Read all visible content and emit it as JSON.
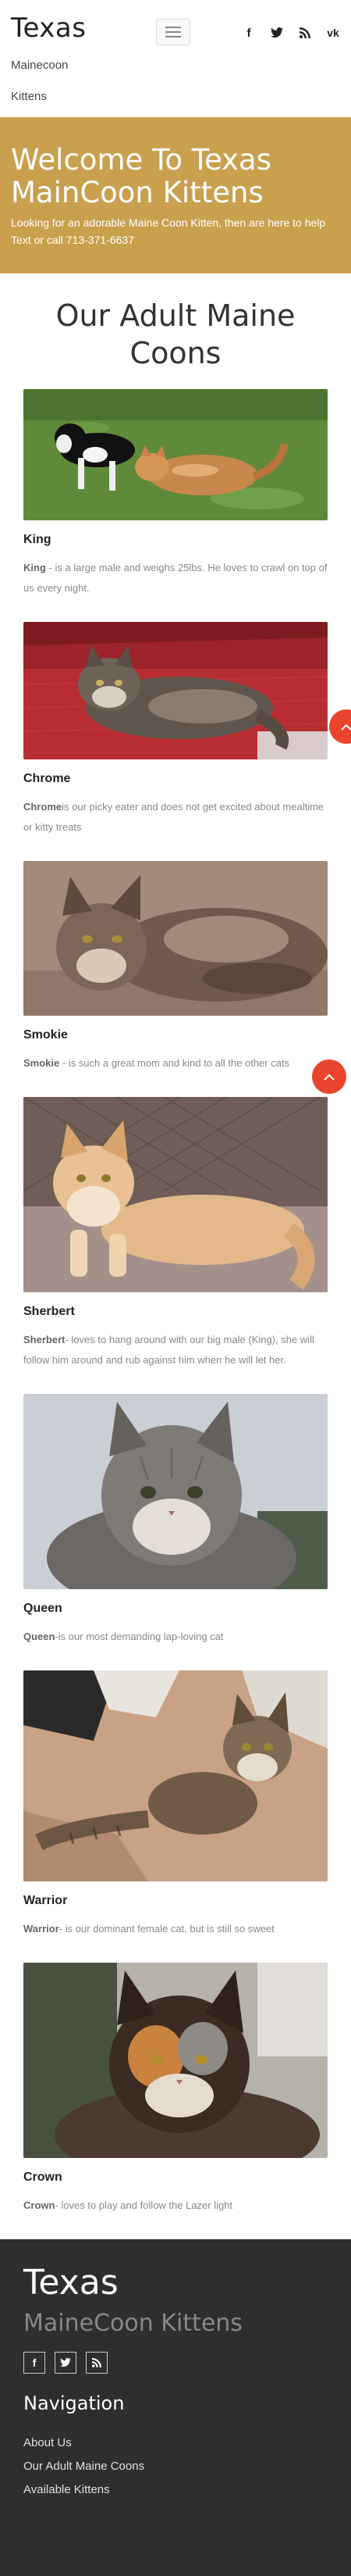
{
  "header": {
    "brand": "Texas",
    "nav": [
      "Mainecoon",
      "Kittens"
    ],
    "social_icons": [
      "facebook-icon",
      "twitter-icon",
      "rss-icon",
      "vk-icon"
    ]
  },
  "hero": {
    "title": "Welcome To Texas MainCoon Kittens",
    "subtitle": "Looking for an adorable Maine Coon Kitten, then are here to help",
    "contact": "Text or call 713-371-6637"
  },
  "section": {
    "title": "Our Adult Maine Coons"
  },
  "cats": [
    {
      "name": "King",
      "desc_strong": "King",
      "desc": " - is a large male and weighs 25lbs. He loves to crawl on top of us every night."
    },
    {
      "name": "Chrome",
      "desc_strong": "Chrome",
      "desc": "is our picky eater and does not get excited about mealtime or kitty treats"
    },
    {
      "name": "Smokie",
      "desc_strong": "Smokie",
      "desc": " - is such a great mom and kind to all the other cats"
    },
    {
      "name": "Sherbert",
      "desc_strong": "Sherbert",
      "desc": "- loves to hang around with our big male (King), she will follow him around and rub against him when he will let her."
    },
    {
      "name": "Queen",
      "desc_strong": "Queen",
      "desc": "-is our most demanding lap-loving cat"
    },
    {
      "name": "Warrior",
      "desc_strong": "Warrior",
      "desc": "- is our dominant female cat, but is still so sweet"
    },
    {
      "name": "Crown",
      "desc_strong": "Crown",
      "desc": "- loves to play and follow the Lazer light"
    }
  ],
  "footer": {
    "brand": "Texas",
    "tagline": "MaineCoon Kittens",
    "nav_title": "Navigation",
    "links": [
      "About Us",
      "Our Adult Maine Coons",
      "Available Kittens"
    ]
  },
  "colors": {
    "hero_bg": "#c9a04e",
    "accent": "#e8452c",
    "footer_bg": "#2d2e30"
  }
}
